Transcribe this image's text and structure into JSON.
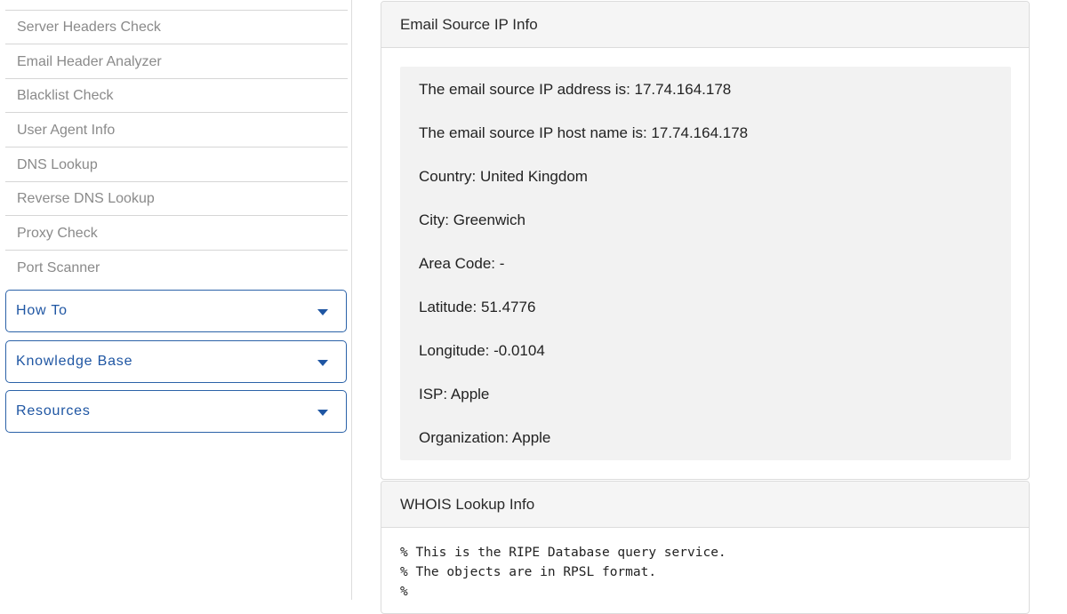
{
  "sidebar": {
    "items": [
      {
        "label": "Server Headers Check"
      },
      {
        "label": "Email Header Analyzer"
      },
      {
        "label": "Blacklist Check"
      },
      {
        "label": "User Agent Info"
      },
      {
        "label": "DNS Lookup"
      },
      {
        "label": "Reverse DNS Lookup"
      },
      {
        "label": "Proxy Check"
      },
      {
        "label": "Port Scanner"
      }
    ],
    "dropdowns": [
      {
        "label": "How To",
        "icon": "chevron-down-icon"
      },
      {
        "label": "Knowledge Base",
        "icon": "chevron-down-icon"
      },
      {
        "label": "Resources",
        "icon": "chevron-down-icon"
      }
    ]
  },
  "ip_panel": {
    "title": "Email Source IP Info",
    "lines": [
      "The email source IP address is: 17.74.164.178",
      "The email source IP host name is: 17.74.164.178",
      "Country: United Kingdom",
      "City: Greenwich",
      "Area Code: -",
      "Latitude: 51.4776",
      "Longitude: -0.0104",
      "ISP: Apple",
      "Organization: Apple"
    ]
  },
  "whois_panel": {
    "title": "WHOIS Lookup Info",
    "lines": [
      "% This is the RIPE Database query service.",
      "% The objects are in RPSL format.",
      "%"
    ]
  },
  "colors": {
    "link_blue": "#1f56a3",
    "muted_text": "#8a8a8a",
    "panel_heading_bg": "#f5f5f5",
    "well_bg": "#f2f2f2"
  }
}
